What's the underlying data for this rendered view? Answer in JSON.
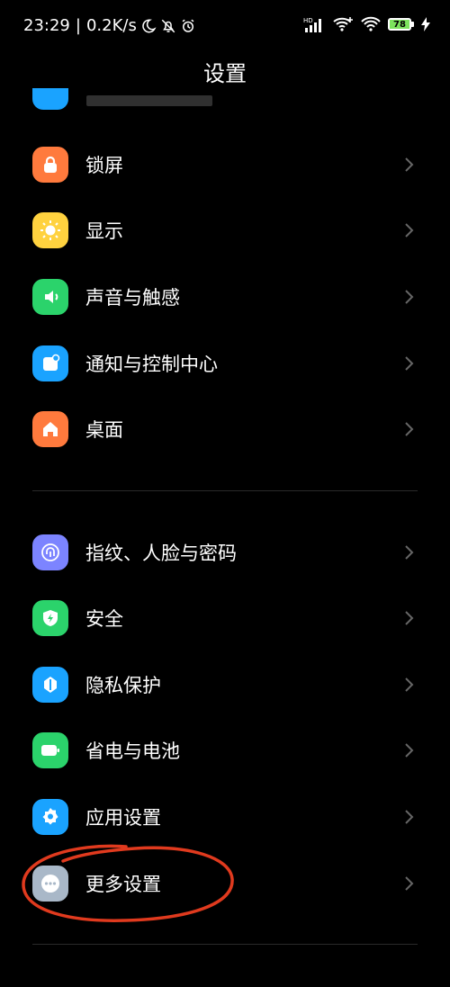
{
  "status_bar": {
    "time": "23:29",
    "network_speed": "0.2K/s",
    "battery_level": "78"
  },
  "header": {
    "title": "设置"
  },
  "group1": [
    {
      "name": "lock-screen",
      "label": "锁屏",
      "icon": "lock-icon",
      "color": "#FF7A3D"
    },
    {
      "name": "display",
      "label": "显示",
      "icon": "sun-icon",
      "color": "#FFD23F"
    },
    {
      "name": "sound-haptics",
      "label": "声音与触感",
      "icon": "speaker-icon",
      "color": "#2BD36B"
    },
    {
      "name": "notifications-control-center",
      "label": "通知与控制中心",
      "icon": "notification-icon",
      "color": "#1AA3FF"
    },
    {
      "name": "home-screen",
      "label": "桌面",
      "icon": "home-icon",
      "color": "#FF7A3D"
    }
  ],
  "group2": [
    {
      "name": "fingerprint-face-password",
      "label": "指纹、人脸与密码",
      "icon": "fingerprint-icon",
      "color": "#7C84FF"
    },
    {
      "name": "security",
      "label": "安全",
      "icon": "shield-bolt-icon",
      "color": "#2BD36B"
    },
    {
      "name": "privacy",
      "label": "隐私保护",
      "icon": "privacy-icon",
      "color": "#1AA3FF"
    },
    {
      "name": "battery",
      "label": "省电与电池",
      "icon": "battery-icon",
      "color": "#2BD36B"
    },
    {
      "name": "app-settings",
      "label": "应用设置",
      "icon": "gear-icon",
      "color": "#1AA3FF"
    },
    {
      "name": "more-settings",
      "label": "更多设置",
      "icon": "more-icon",
      "color": "#A9B8C8"
    }
  ],
  "annotation": {
    "circle_color": "#E03A1E"
  }
}
